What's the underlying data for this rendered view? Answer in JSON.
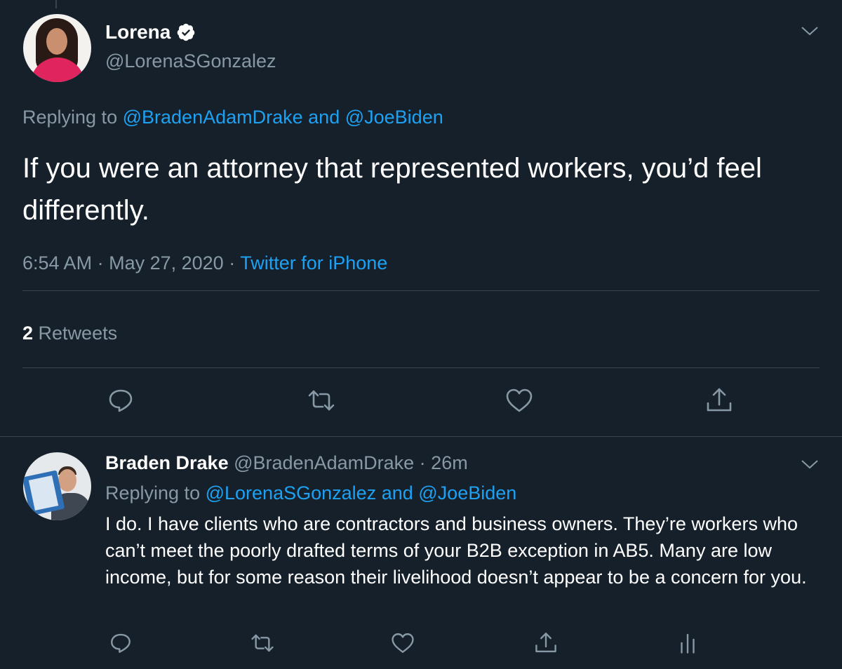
{
  "main_tweet": {
    "author_name": "Lorena",
    "author_handle": "@LorenaSGonzalez",
    "replying_prefix": "Replying to",
    "replying_to_1": "@BradenAdamDrake",
    "replying_conj": "and",
    "replying_to_2": "@JoeBiden",
    "text": "If you were an attorney that represented workers, you’d feel differently.",
    "time": "6:54 AM",
    "date": "May 27, 2020",
    "separator": "·",
    "source": "Twitter for iPhone",
    "retweet_count": "2",
    "retweet_label": "Retweets",
    "icons": [
      "verified-badge-icon",
      "chevron-down-icon",
      "reply-icon",
      "retweet-icon",
      "like-icon",
      "share-icon"
    ]
  },
  "reply_tweet": {
    "author_name": "Braden Drake",
    "author_handle": "@BradenAdamDrake",
    "separator": "·",
    "time_ago": "26m",
    "replying_prefix": "Replying to",
    "replying_to_1": "@LorenaSGonzalez",
    "replying_conj": "and",
    "replying_to_2": "@JoeBiden",
    "text": "I do. I have clients who are contractors and business owners. They’re workers who can’t meet the poorly drafted terms of your B2B exception in AB5. Many are low income, but for some reason their livelihood doesn’t appear to be a concern for you.",
    "icons": [
      "chevron-down-icon",
      "reply-icon",
      "retweet-icon",
      "like-icon",
      "share-icon",
      "analytics-icon"
    ]
  },
  "colors": {
    "background": "#15202b",
    "text": "#ffffff",
    "muted": "#8899a6",
    "link": "#1da1f2",
    "divider": "#38444d"
  }
}
